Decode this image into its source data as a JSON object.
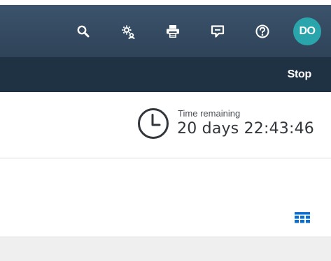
{
  "shell": {
    "actions": [
      {
        "id": "search",
        "icon": "search-icon"
      },
      {
        "id": "settings",
        "icon": "settings-icon"
      },
      {
        "id": "print",
        "icon": "printer-icon"
      },
      {
        "id": "feedback",
        "icon": "feedback-icon"
      },
      {
        "id": "help",
        "icon": "help-icon"
      }
    ],
    "user_initials": "DO"
  },
  "subbar": {
    "stop_label": "Stop"
  },
  "timer": {
    "label": "Time remaining",
    "value": "20 days 22:43:46",
    "icon": "clock-icon"
  },
  "toolbar": {
    "view_toggle_icon": "grid-view-icon"
  },
  "colors": {
    "shell_bg": "#344a61",
    "subbar_bg": "#1f3244",
    "avatar_bg": "#2aa5ac",
    "accent_blue": "#0a6ed1",
    "panel_bg": "#efefef"
  }
}
